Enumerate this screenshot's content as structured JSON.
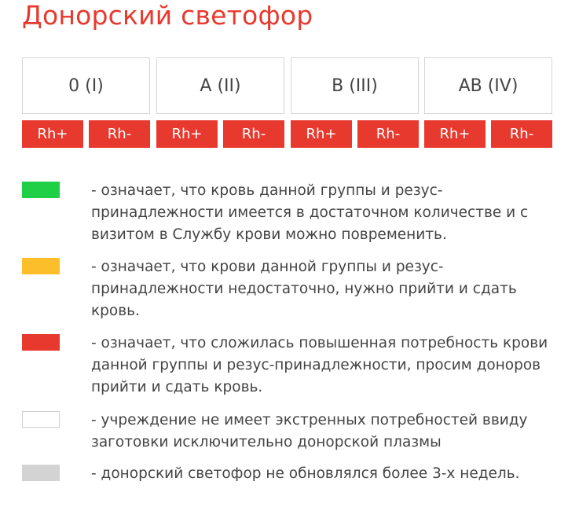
{
  "title": "Донорский светофор",
  "groups": [
    {
      "label": "0 (I)",
      "rh_plus": "Rh+",
      "rh_minus": "Rh-"
    },
    {
      "label": "A (II)",
      "rh_plus": "Rh+",
      "rh_minus": "Rh-"
    },
    {
      "label": "B (III)",
      "rh_plus": "Rh+",
      "rh_minus": "Rh-"
    },
    {
      "label": "AB (IV)",
      "rh_plus": "Rh+",
      "rh_minus": "Rh-"
    }
  ],
  "colors": {
    "accent": "#e8392e",
    "green": "#1fcf46",
    "yellow": "#fcbf2b",
    "red": "#e8392e",
    "white": "#ffffff",
    "gray": "#d3d3d3"
  },
  "legend": [
    {
      "color": "green",
      "text": "- означает, что кровь данной группы и резус-принадлежности имеется в достаточном количестве и с визитом в Службу крови можно повременить."
    },
    {
      "color": "yellow",
      "text": "- означает, что крови данной группы и резус-принадлежности недостаточно, нужно прийти и сдать кровь."
    },
    {
      "color": "red",
      "text": "- означает, что сложилась повышенная потребность крови данной группы и резус-принадлежности, просим доноров прийти и сдать кровь."
    },
    {
      "color": "white",
      "text": "- учреждение не имеет экстренных потребностей ввиду заготовки исключительно донорской плазмы"
    },
    {
      "color": "gray",
      "text": "- донорский светофор не обновлялся более 3-х недель."
    }
  ]
}
